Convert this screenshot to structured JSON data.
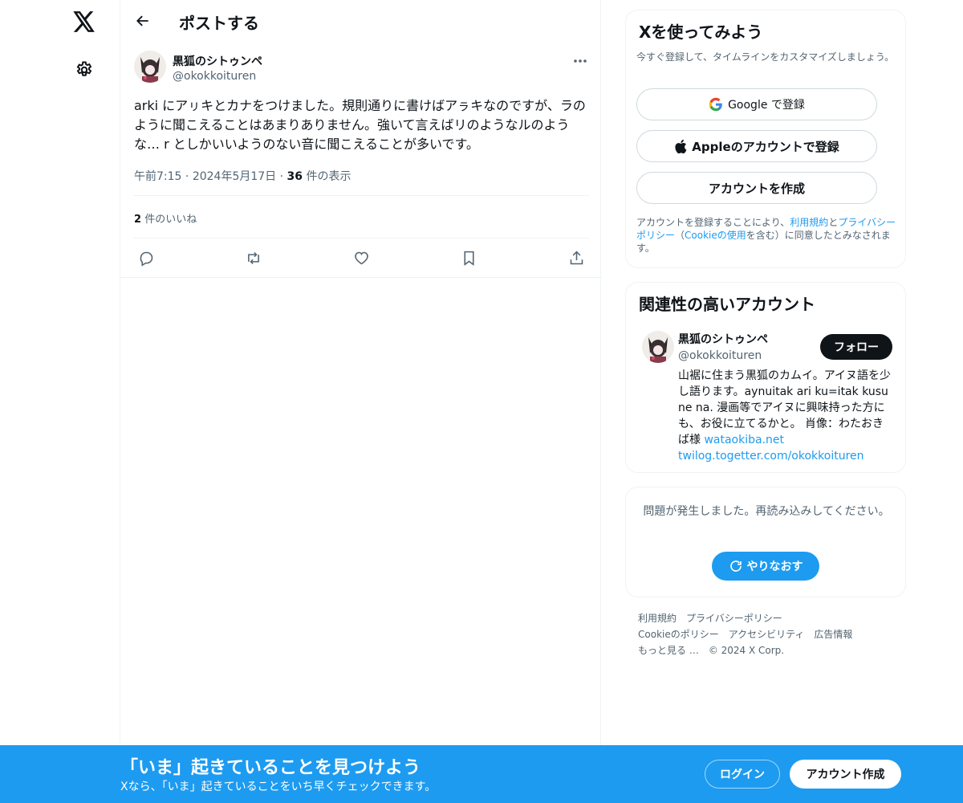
{
  "nav": {
    "logo_icon": "x-logo-icon",
    "settings_icon": "gear-icon"
  },
  "header": {
    "back_icon": "arrow-left-icon",
    "title": "ポストする"
  },
  "post": {
    "author_name": "黒狐のシトゥンペ",
    "author_handle": "@okokkoituren",
    "text": "arki にアㇼキとカナをつけました。規則通りに書けばアㇻキなのですが、ラのように聞こえることはあまりありません。強いて言えばリのようなルのような… r としかいいようのない音に聞こえることが多いです。",
    "time": "午前7:15",
    "date": "2024年5月17日",
    "views_count": "36",
    "views_label": "件の表示",
    "likes_count": "2",
    "likes_label": "件のいいね",
    "actions": [
      "reply-icon",
      "repost-icon",
      "like-icon",
      "bookmark-icon",
      "share-icon"
    ]
  },
  "signup": {
    "title": "Xを使ってみよう",
    "subtitle": "今すぐ登録して、タイムラインをカスタマイズしましょう。",
    "google_label": "Google で登録",
    "apple_label": "Appleのアカウントで登録",
    "create_label": "アカウントを作成",
    "legal_prefix": "アカウントを登録することにより、",
    "legal_terms": "利用規約",
    "legal_and": "と",
    "legal_privacy": "プライバシーポリシー",
    "legal_paren_open": "（",
    "legal_cookie": "Cookieの使用",
    "legal_suffix": "を含む）に同意したとみなされます。"
  },
  "related": {
    "title": "関連性の高いアカウント",
    "name": "黒狐のシトゥンペ",
    "handle": "@okokkoituren",
    "follow_label": "フォロー",
    "bio": "山裾に住まう黒狐のカムイ。アイヌ語を少し語ります。aynuitak ari ku=itak kusu ne na. 漫画等でアイヌに興味持った方にも、お役に立てるかと。 肖像：わたおきば様 ",
    "bio_link1": "wataokiba.net",
    "bio_link2": "twilog.togetter.com/okokkoituren"
  },
  "error": {
    "message": "問題が発生しました。再読み込みしてください。",
    "retry_label": "やりなおす"
  },
  "footer": {
    "links": [
      "利用規約",
      "プライバシーポリシー",
      "Cookieのポリシー",
      "アクセシビリティ",
      "広告情報",
      "もっと見る …",
      "© 2024 X Corp."
    ]
  },
  "banner": {
    "title": "「いま」起きていることを見つけよう",
    "subtitle": "Xなら、「いま」起きていることをいち早くチェックできます。",
    "login_label": "ログイン",
    "signup_label": "アカウント作成"
  },
  "colors": {
    "accent": "#1d9bf0",
    "text": "#0f1419",
    "muted": "#536471",
    "border": "#eff3f4"
  }
}
